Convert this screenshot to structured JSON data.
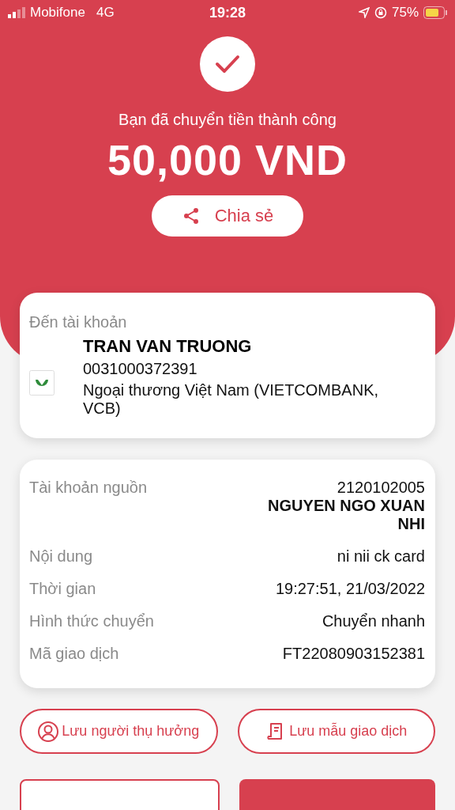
{
  "status_bar": {
    "carrier": "Mobifone",
    "network": "4G",
    "time": "19:28",
    "battery": "75%"
  },
  "header": {
    "message": "Bạn đã chuyển tiền thành công",
    "amount": "50,000 VND",
    "share_button": "Chia sẻ"
  },
  "recipient": {
    "label": "Đến tài khoản",
    "name": "TRAN VAN TRUONG",
    "account": "0031000372391",
    "bank": "Ngoại thương Việt Nam (VIETCOMBANK, VCB)"
  },
  "details": [
    {
      "kind": "account",
      "label": "Tài khoản nguồn",
      "value": "2120102005",
      "holder": "NGUYEN NGO XUAN NHI"
    },
    {
      "kind": "text",
      "label": "Nội dung",
      "value": "ni nii ck card"
    },
    {
      "kind": "text",
      "label": "Thời gian",
      "value": "19:27:51, 21/03/2022"
    },
    {
      "kind": "text",
      "label": "Hình thức chuyển",
      "value": "Chuyển nhanh"
    },
    {
      "kind": "text",
      "label": "Mã giao dịch",
      "value": "FT22080903152381"
    }
  ],
  "actions": [
    {
      "kind": "person",
      "label": "Lưu người thụ hưởng"
    },
    {
      "kind": "receipt",
      "label": "Lưu mẫu giao dịch"
    }
  ],
  "bottom_buttons": [
    {
      "kind": "outline"
    },
    {
      "kind": "filled"
    }
  ]
}
